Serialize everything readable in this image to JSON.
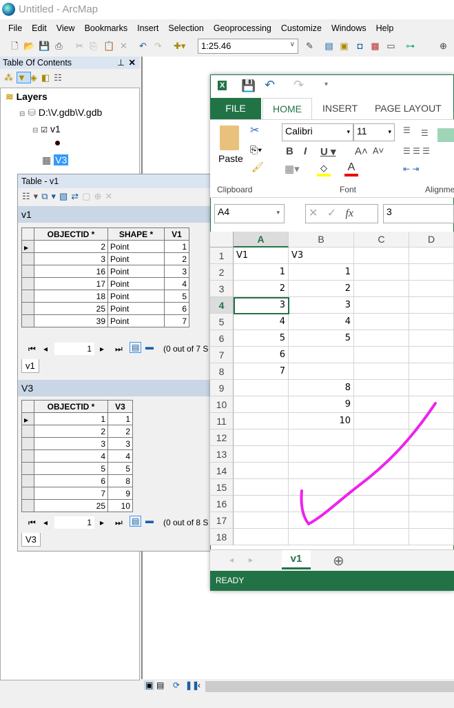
{
  "window": {
    "title": "Untitled - ArcMap"
  },
  "menu": [
    "File",
    "Edit",
    "View",
    "Bookmarks",
    "Insert",
    "Selection",
    "Geoprocessing",
    "Customize",
    "Windows",
    "Help"
  ],
  "toolbar": {
    "scale": "1:25.46"
  },
  "toc": {
    "title": "Table Of Contents",
    "root": "Layers",
    "database": "D:\\V.gdb\\V.gdb",
    "layer": "v1",
    "layer_checked": true,
    "table": "V3"
  },
  "table_window": {
    "title": "Table - v1",
    "v1": {
      "name": "v1",
      "columns": [
        "OBJECTID *",
        "SHAPE *",
        "V1"
      ],
      "rows": [
        [
          "2",
          "Point",
          "1"
        ],
        [
          "3",
          "Point",
          "2"
        ],
        [
          "16",
          "Point",
          "3"
        ],
        [
          "17",
          "Point",
          "4"
        ],
        [
          "18",
          "Point",
          "5"
        ],
        [
          "25",
          "Point",
          "6"
        ],
        [
          "39",
          "Point",
          "7"
        ]
      ],
      "record": "1",
      "selection": "(0 out of 7 S",
      "tab": "v1"
    },
    "v3": {
      "name": "V3",
      "columns": [
        "OBJECTID *",
        "V3"
      ],
      "rows": [
        [
          "1",
          "1"
        ],
        [
          "2",
          "2"
        ],
        [
          "3",
          "3"
        ],
        [
          "4",
          "4"
        ],
        [
          "5",
          "5"
        ],
        [
          "6",
          "8"
        ],
        [
          "7",
          "9"
        ],
        [
          "25",
          "10"
        ]
      ],
      "record": "1",
      "selection": "(0 out of 8 S",
      "tab": "V3"
    }
  },
  "excel": {
    "tabs": [
      "FILE",
      "HOME",
      "INSERT",
      "PAGE LAYOUT"
    ],
    "active_tab": "HOME",
    "font": "Calibri",
    "font_size": "11",
    "paste": "Paste",
    "groups": [
      "Clipboard",
      "Font",
      "Alignme"
    ],
    "name_box": "A4",
    "formula": "3",
    "fx": "fx",
    "columns": [
      "A",
      "B",
      "C",
      "D"
    ],
    "rows": [
      [
        "V1",
        "V3"
      ],
      [
        "1",
        "1"
      ],
      [
        "2",
        "2"
      ],
      [
        "3",
        "3"
      ],
      [
        "4",
        "4"
      ],
      [
        "5",
        "5"
      ],
      [
        "6",
        ""
      ],
      [
        "7",
        ""
      ],
      [
        "",
        "8"
      ],
      [
        "",
        "9"
      ],
      [
        "",
        "10"
      ],
      [
        "",
        ""
      ],
      [
        "",
        ""
      ],
      [
        "",
        ""
      ],
      [
        "",
        ""
      ],
      [
        "",
        ""
      ],
      [
        "",
        ""
      ],
      [
        "",
        ""
      ]
    ],
    "active_cell": "A4",
    "sheet_tab": "v1",
    "status": "READY",
    "colors": {
      "accent": "#217346",
      "annotation": "#ee22ee"
    }
  }
}
